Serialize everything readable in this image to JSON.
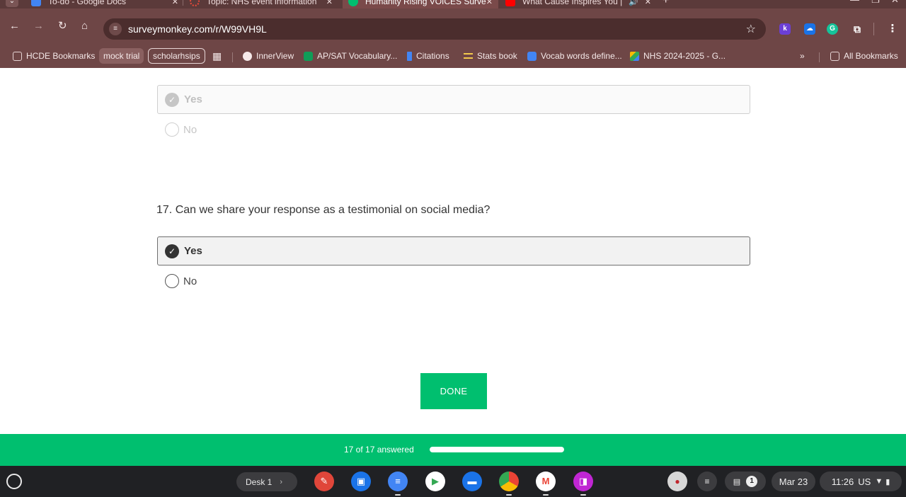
{
  "browser": {
    "tabs": [
      {
        "title": "To-do - Google Docs",
        "icon": "docs-icon",
        "color": "#4285f4"
      },
      {
        "title": "Topic: NHS event information",
        "icon": "loading-icon",
        "color": "#e84a3a"
      },
      {
        "title": "Humanity Rising VOICES Surve",
        "icon": "surveymonkey-icon",
        "color": "#00bf6f"
      },
      {
        "title": "What Cause Inspires You | ",
        "icon": "youtube-icon",
        "color": "#ff0000"
      }
    ],
    "url": "surveymonkey.com/r/W99VH9L",
    "bookmarks": [
      {
        "label": "HCDE Bookmarks",
        "icon": "folder-icon"
      },
      {
        "label": "mock trial",
        "style": "pill"
      },
      {
        "label": "scholarhsips",
        "style": "outline"
      },
      {
        "label": "InnerView",
        "icon": "innerview-icon"
      },
      {
        "label": "AP/SAT Vocabulary...",
        "icon": "sheets-icon"
      },
      {
        "label": "Citations",
        "icon": "bookmark-icon"
      },
      {
        "label": "Stats book",
        "icon": "stats-icon"
      },
      {
        "label": "Vocab words define...",
        "icon": "docs-icon"
      },
      {
        "label": "NHS 2024-2025 - G...",
        "icon": "drive-icon"
      }
    ],
    "bookmarks_overflow": "»",
    "all_bookmarks": "All Bookmarks"
  },
  "survey": {
    "prev_question": {
      "options": [
        {
          "label": "Yes",
          "selected": true
        },
        {
          "label": "No",
          "selected": false
        }
      ]
    },
    "question": {
      "text": "17. Can we share your response as a testimonial on social media?",
      "options": [
        {
          "label": "Yes",
          "selected": true
        },
        {
          "label": "No",
          "selected": false
        }
      ]
    },
    "done_label": "DONE",
    "progress": {
      "text": "17 of 17 answered",
      "answered": 17,
      "total": 17
    }
  },
  "shelf": {
    "desk_label": "Desk 1",
    "date": "Mar 23",
    "time": "11:26",
    "locale": "US",
    "notification_count": "1"
  },
  "colors": {
    "accent": "#00bf6f",
    "browser_frame": "#6e4646"
  }
}
